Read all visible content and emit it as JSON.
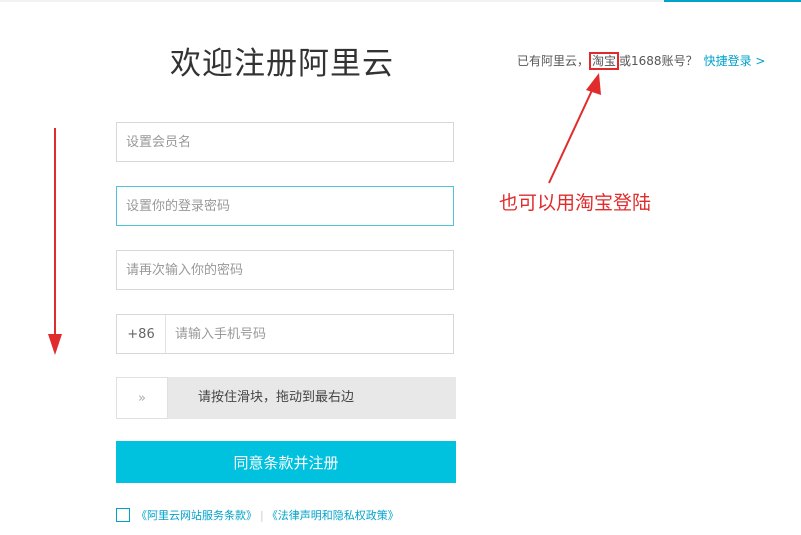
{
  "page": {
    "title": "欢迎注册阿里云"
  },
  "login_hint": {
    "prefix": "已有阿里云，",
    "taobao": "淘宝",
    "suffix": "或1688账号？",
    "quick_login": "快捷登录 >"
  },
  "form": {
    "username_placeholder": "设置会员名",
    "password_placeholder": "设置你的登录密码",
    "confirm_placeholder": "请再次输入你的密码",
    "phone_prefix": "+86",
    "phone_placeholder": "请输入手机号码",
    "slider_handle": "»",
    "slider_text": "请按住滑块，拖动到最右边",
    "submit_label": "同意条款并注册"
  },
  "agreement": {
    "terms": "《阿里云网站服务条款》",
    "separator": "|",
    "privacy": "《法律声明和隐私权政策》"
  },
  "annotation": {
    "text": "也可以用淘宝登陆",
    "color": "#e02c2c"
  },
  "colors": {
    "accent": "#00a2ca",
    "button": "#00c1de",
    "annotation_red": "#e02c2c"
  },
  "icons": {
    "slider_handle": "double-chevron-right-icon",
    "arrow_up": "red-arrow-up-icon",
    "arrow_down": "red-arrow-down-icon"
  }
}
